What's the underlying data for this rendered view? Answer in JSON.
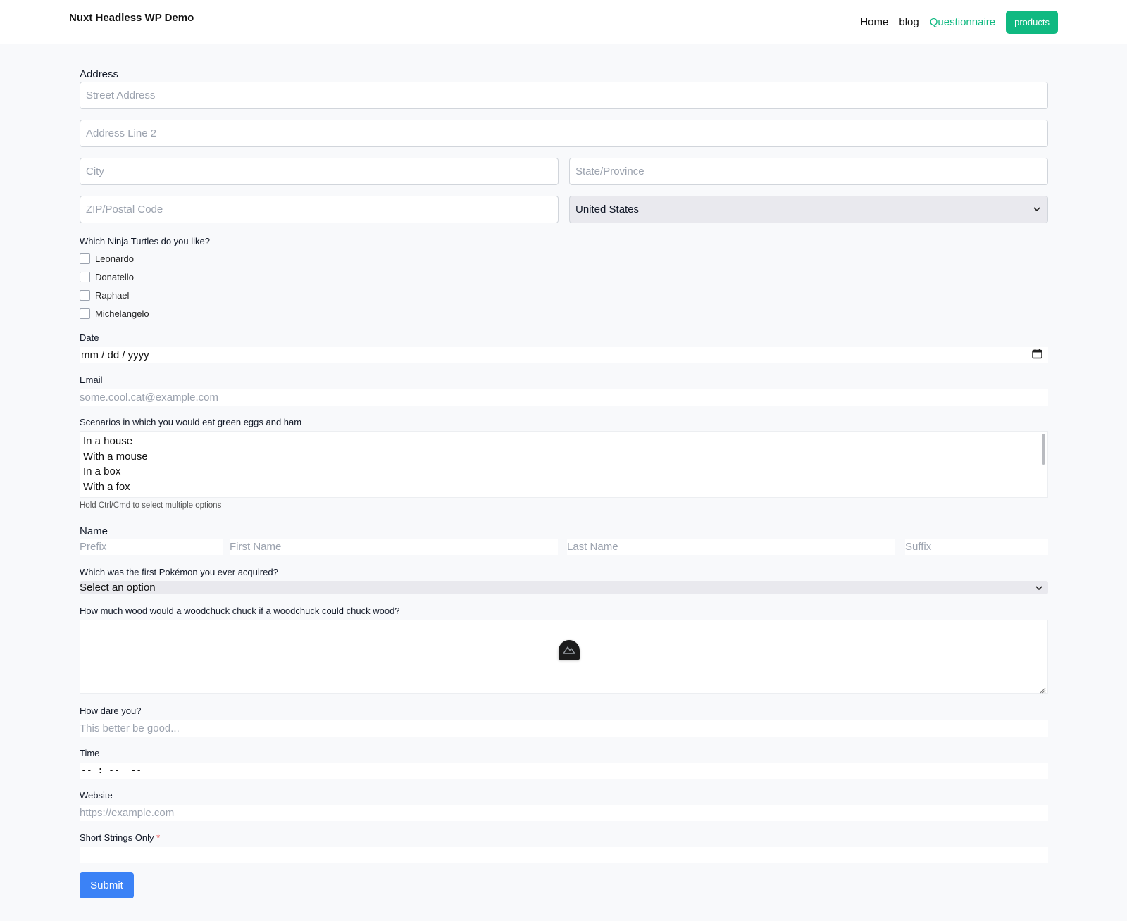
{
  "header": {
    "brand": "Nuxt Headless WP Demo",
    "nav": {
      "home": "Home",
      "blog": "blog",
      "questionnaire": "Questionnaire",
      "products": "products"
    }
  },
  "address": {
    "label": "Address",
    "street_placeholder": "Street Address",
    "line2_placeholder": "Address Line 2",
    "city_placeholder": "City",
    "state_placeholder": "State/Province",
    "zip_placeholder": "ZIP/Postal Code",
    "country_value": "United States"
  },
  "turtles": {
    "label": "Which Ninja Turtles do you like?",
    "options": [
      "Leonardo",
      "Donatello",
      "Raphael",
      "Michelangelo"
    ]
  },
  "date": {
    "label": "Date",
    "value": "mm / dd / yyyy"
  },
  "email": {
    "label": "Email",
    "placeholder": "some.cool.cat@example.com"
  },
  "scenarios": {
    "label": "Scenarios in which you would eat green eggs and ham",
    "options": [
      "In a house",
      "With a mouse",
      "In a box",
      "With a fox"
    ],
    "hint": "Hold Ctrl/Cmd to select multiple options"
  },
  "name": {
    "label": "Name",
    "prefix_placeholder": "Prefix",
    "first_placeholder": "First Name",
    "last_placeholder": "Last Name",
    "suffix_placeholder": "Suffix"
  },
  "pokemon": {
    "label": "Which was the first Pokémon you ever acquired?",
    "value": "Select an option"
  },
  "woodchuck": {
    "label": "How much wood would a woodchuck chuck if a woodchuck could chuck wood?"
  },
  "dare": {
    "label": "How dare you?",
    "placeholder": "This better be good..."
  },
  "time": {
    "label": "Time",
    "value": "-- : --  --"
  },
  "website": {
    "label": "Website",
    "placeholder": "https://example.com"
  },
  "short_strings": {
    "label": "Short Strings Only",
    "required_mark": "*"
  },
  "submit": {
    "label": "Submit"
  },
  "icons": {
    "chevron": "chevron-down-icon",
    "calendar": "calendar-icon",
    "nuxt": "nuxt-devtools-icon"
  },
  "colors": {
    "accent": "#10b981",
    "submit": "#3b82f6",
    "required": "#ef4444"
  }
}
